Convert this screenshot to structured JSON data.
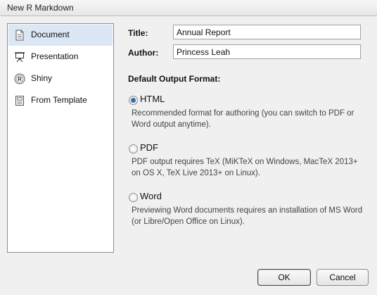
{
  "window": {
    "title": "New R Markdown"
  },
  "sidebar": {
    "items": [
      {
        "label": "Document",
        "icon": "document-icon",
        "selected": true
      },
      {
        "label": "Presentation",
        "icon": "presentation-icon",
        "selected": false
      },
      {
        "label": "Shiny",
        "icon": "shiny-icon",
        "selected": false
      },
      {
        "label": "From Template",
        "icon": "template-icon",
        "selected": false
      }
    ]
  },
  "form": {
    "title_label": "Title:",
    "title_value": "Annual Report",
    "author_label": "Author:",
    "author_value": "Princess Leah"
  },
  "output": {
    "heading": "Default Output Format:",
    "options": [
      {
        "label": "HTML",
        "checked": true,
        "desc": "Recommended format for authoring (you can switch to PDF or Word output anytime)."
      },
      {
        "label": "PDF",
        "checked": false,
        "desc": "PDF output requires TeX (MiKTeX on Windows, MacTeX 2013+ on OS X, TeX Live 2013+ on Linux)."
      },
      {
        "label": "Word",
        "checked": false,
        "desc": "Previewing Word documents requires an installation of MS Word (or Libre/Open Office on Linux)."
      }
    ]
  },
  "buttons": {
    "ok": "OK",
    "cancel": "Cancel"
  },
  "colors": {
    "selection": "#dce7f5",
    "radio_dot": "#3a6db0"
  }
}
